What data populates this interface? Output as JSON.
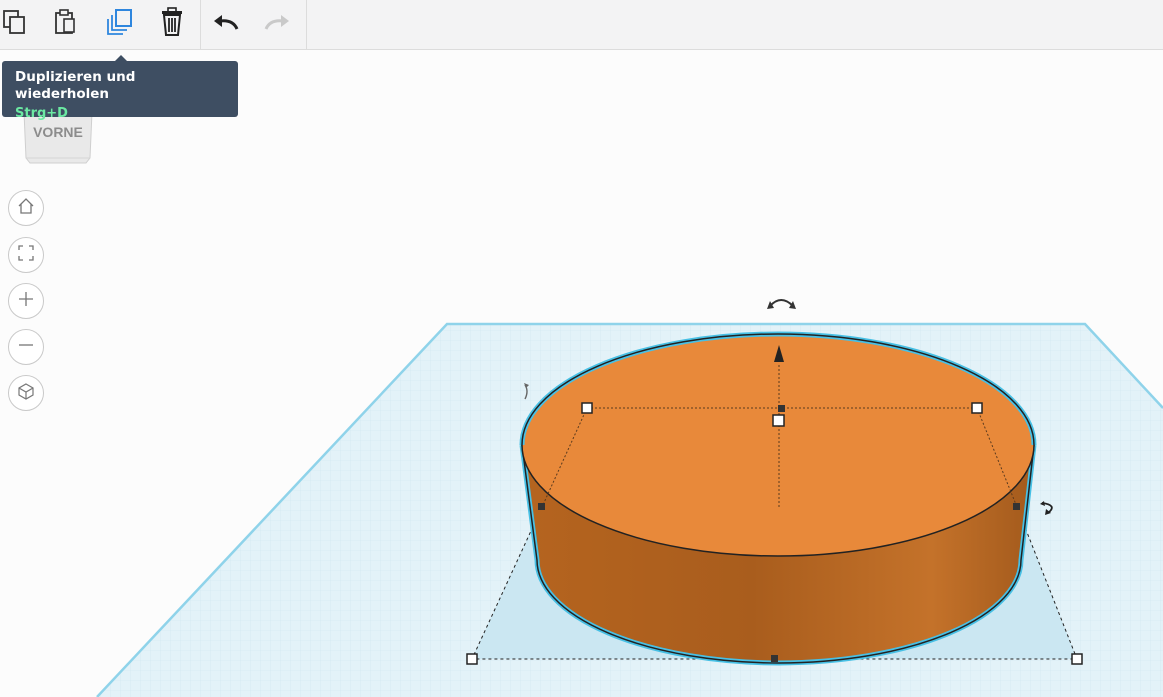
{
  "toolbar": {
    "edit_tools": [
      {
        "name": "copy-icon",
        "label": "Kopieren"
      },
      {
        "name": "paste-icon",
        "label": "Einfügen"
      },
      {
        "name": "duplicate-icon",
        "label": "Duplizieren und wiederholen",
        "active": true
      },
      {
        "name": "trash-icon",
        "label": "Löschen"
      }
    ],
    "history_tools": [
      {
        "name": "undo-icon",
        "enabled": true
      },
      {
        "name": "redo-icon",
        "enabled": false
      }
    ]
  },
  "tooltip": {
    "title": "Duplizieren und wiederholen",
    "shortcut": "Strg+D"
  },
  "viewcube": {
    "face_label": "VORNE"
  },
  "view_controls": [
    "home-icon",
    "fit-view-icon",
    "zoom-in-icon",
    "zoom-out-icon",
    "perspective-cube-icon"
  ],
  "colors": {
    "shape_fill": "#e8893a",
    "shape_side": "#c46d25",
    "selection_outline": "#3cb6dc",
    "workplane": "#e3f2f8",
    "tooltip_bg": "#3e4e62",
    "shortcut_text": "#6be9a2",
    "active_tool": "#2e86de"
  }
}
